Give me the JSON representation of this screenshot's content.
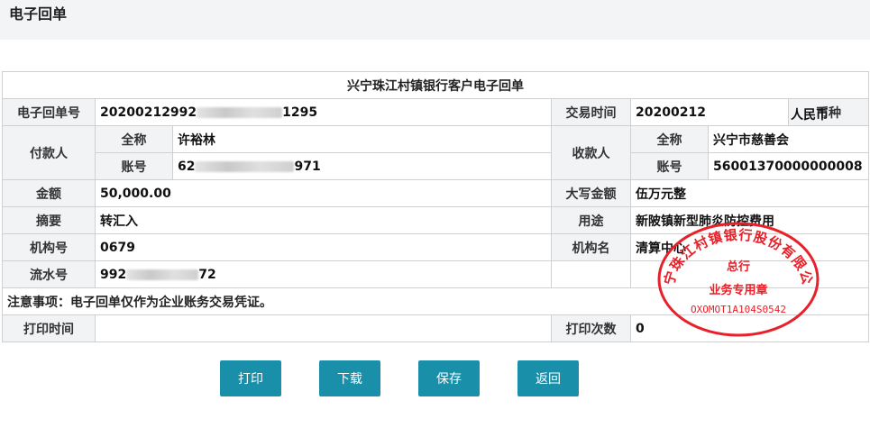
{
  "page": {
    "title": "电子回单"
  },
  "receipt": {
    "caption": "兴宁珠江村镇银行客户电子回单",
    "receipt_no_label": "电子回单号",
    "receipt_no_prefix": "20200212992",
    "receipt_no_suffix": "1295",
    "trade_time_label": "交易时间",
    "trade_time": "20200212",
    "currency_label": "币种",
    "currency": "人民币",
    "payer_label": "付款人",
    "payee_label": "收款人",
    "name_label": "全称",
    "account_label": "账号",
    "payer_name": "许裕林",
    "payer_account_prefix": "62",
    "payer_account_suffix": "971",
    "payee_name": "兴宁市慈善会",
    "payee_account": "56001370000000008",
    "amount_label": "金额",
    "amount": "50,000.00",
    "amount_upper_label": "大写金额",
    "amount_upper": "伍万元整",
    "summary_label": "摘要",
    "summary": "转汇入",
    "purpose_label": "用途",
    "purpose": "新陂镇新型肺炎防控费用",
    "org_no_label": "机构号",
    "org_no": "0679",
    "org_name_label": "机构名",
    "org_name": "清算中心",
    "serial_label": "流水号",
    "serial_prefix": "992",
    "serial_suffix": "72",
    "note": "注意事项：电子回单仅作为企业账务交易凭证。",
    "print_time_label": "打印时间",
    "print_time": "",
    "print_count_label": "打印次数",
    "print_count": "0"
  },
  "stamp": {
    "org": "兴宁珠江村镇银行股份有限公司",
    "line1": "总行",
    "line2": "业务专用章",
    "code": "OXOMOT1A104S0542",
    "color": "#e8202a"
  },
  "buttons": {
    "print": "打印",
    "download": "下载",
    "save": "保存",
    "back": "返回"
  },
  "colors": {
    "button": "#1a8fa9",
    "header_cell": "#f2f3f5"
  }
}
